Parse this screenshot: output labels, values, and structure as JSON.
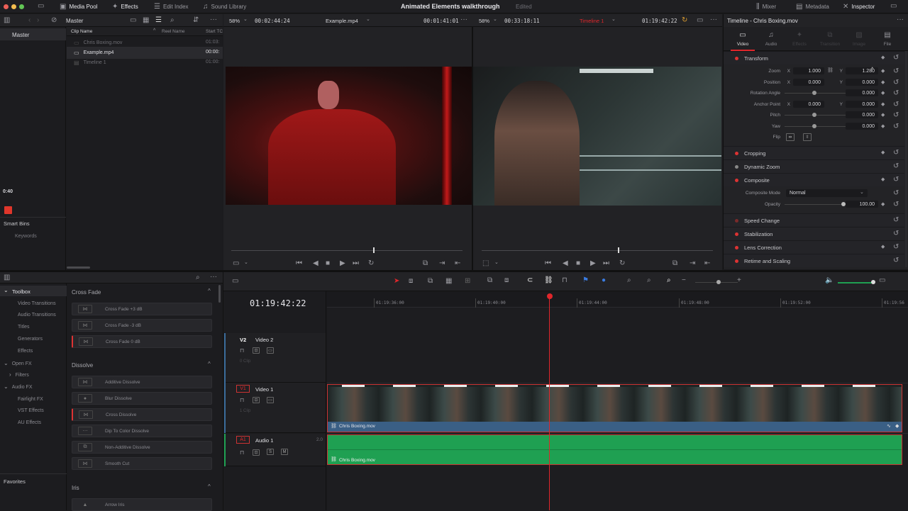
{
  "topbar": {
    "media_pool": "Media Pool",
    "effects": "Effects",
    "edit_index": "Edit Index",
    "sound_library": "Sound Library",
    "project_title": "Animated Elements walkthrough",
    "project_status": "Edited",
    "mixer": "Mixer",
    "metadata": "Metadata",
    "inspector": "Inspector"
  },
  "media_pool": {
    "bin": "Master",
    "col_clip_name": "Clip Name",
    "col_reel_name": "Reel Name",
    "col_start": "Start TC",
    "sidebar_master": "Master",
    "sidebar_time": "0:40",
    "smart_bins": "Smart Bins",
    "keywords": "Keywords",
    "clips": [
      {
        "name": "Chris Boxing.mov",
        "start": "01:03:"
      },
      {
        "name": "Example.mp4",
        "start": "00:00:"
      },
      {
        "name": "Timeline 1",
        "start": "01:00:"
      }
    ]
  },
  "source_viewer": {
    "zoom": "58%",
    "timecode": "00:02:44:24",
    "clip": "Example.mp4",
    "duration": "00:01:41:01"
  },
  "timeline_viewer": {
    "zoom": "58%",
    "timecode": "00:33:18:11",
    "timeline": "Timeline 1",
    "current_tc": "01:19:42:22"
  },
  "inspector": {
    "title": "Timeline - Chris Boxing.mov",
    "tabs": [
      "Video",
      "Audio",
      "Effects",
      "Transition",
      "Image",
      "File"
    ],
    "transform": "Transform",
    "zoom_label": "Zoom",
    "zoom_x": "1.000",
    "zoom_y": "1.280",
    "position_label": "Position",
    "pos_x": "0.000",
    "pos_y": "0.000",
    "rotation_label": "Rotation Angle",
    "rotation": "0.000",
    "anchor_label": "Anchor Point",
    "anchor_x": "0.000",
    "anchor_y": "0.000",
    "pitch_label": "Pitch",
    "pitch": "0.000",
    "yaw_label": "Yaw",
    "yaw": "0.000",
    "flip_label": "Flip",
    "x": "X",
    "y": "Y",
    "cropping": "Cropping",
    "dynamic_zoom": "Dynamic Zoom",
    "composite": "Composite",
    "composite_mode_label": "Composite Mode",
    "composite_mode": "Normal",
    "opacity_label": "Opacity",
    "opacity": "100.00",
    "speed_change": "Speed Change",
    "stabilization": "Stabilization",
    "lens_correction": "Lens Correction",
    "retime": "Retime and Scaling"
  },
  "effects": {
    "toolbox": "Toolbox",
    "tree": [
      "Video Transitions",
      "Audio Transitions",
      "Titles",
      "Generators",
      "Effects"
    ],
    "open_fx": "Open FX",
    "filters": "Filters",
    "audio_fx": "Audio FX",
    "audio_tree": [
      "Fairlight FX",
      "VST Effects",
      "AU Effects"
    ],
    "favorites": "Favorites",
    "cross_fade_group": "Cross Fade",
    "cross_fade": [
      "Cross Fade +3 dB",
      "Cross Fade -3 dB",
      "Cross Fade 0 dB"
    ],
    "dissolve_group": "Dissolve",
    "dissolve": [
      "Additive Dissolve",
      "Blur Dissolve",
      "Cross Dissolve",
      "Dip To Color Dissolve",
      "Non-Additive Dissolve",
      "Smooth Cut"
    ],
    "iris_group": "Iris",
    "iris": [
      "Arrow Iris"
    ]
  },
  "timeline": {
    "timecode": "01:19:42:22",
    "ruler": [
      "01:19:36:00",
      "01:19:40:00",
      "01:19:44:00",
      "01:19:48:00",
      "01:19:52:00",
      "01:19:56"
    ],
    "tracks": {
      "v2": {
        "id": "V2",
        "name": "Video 2",
        "clips": "0 Clip"
      },
      "v1": {
        "id": "V1",
        "name": "Video 1",
        "clips": "1 Clip"
      },
      "a1": {
        "id": "A1",
        "name": "Audio 1",
        "channels": "2.0",
        "s": "S",
        "m": "M"
      }
    },
    "video_clip": "Chris Boxing.mov",
    "audio_clip": "Chris Boxing.mov"
  },
  "colors": {
    "accent_red": "#e0262b",
    "audio_green": "#1fa052",
    "clip_blue": "#3a5f85"
  }
}
